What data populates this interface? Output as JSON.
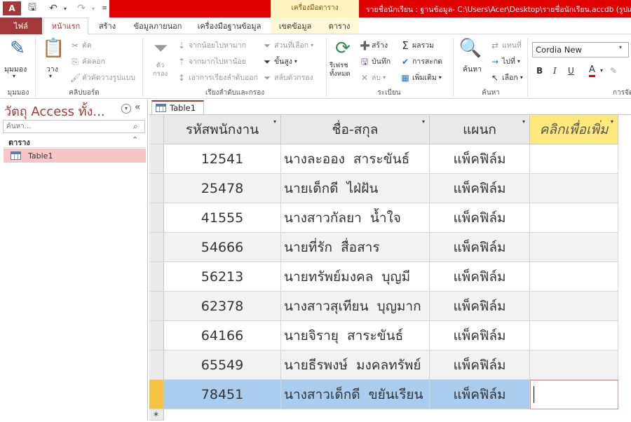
{
  "app": {
    "title": "รายชื่อนักเรียน : ฐานข้อมูล- C:\\Users\\Acer\\Desktop\\รายชื่อนักเรียน.accdb (รูปแบ",
    "context_group": "เครื่องมือตาราง",
    "app_icon_label": "A"
  },
  "tabs": {
    "file": "ไฟล์",
    "items": [
      "หน้าแรก",
      "สร้าง",
      "ข้อมูลภายนอก",
      "เครื่องมือฐานข้อมูล",
      "เขตข้อมูล",
      "ตาราง"
    ],
    "active_index": 0
  },
  "ribbon": {
    "views": {
      "label": "มุมมอง",
      "group": "มุมมอง"
    },
    "clipboard": {
      "paste": "วาง",
      "cut": "ตัด",
      "copy": "คัดลอก",
      "format_painter": "ตัวคัดวางรูปแบบ",
      "group": "คลิปบอร์ด"
    },
    "sort_filter": {
      "filter": "ตัว\nกรอง",
      "ascending": "จากน้อยไปหามาก",
      "descending": "จากมากไปหาน้อย",
      "remove_sort": "เอาการเรียงลำดับออก",
      "selection": "ส่วนที่เลือก",
      "advanced": "ขั้นสูง",
      "toggle_filter": "สลับตัวกรอง",
      "group": "เรียงลำดับและกรอง"
    },
    "records": {
      "refresh": "รีเฟรช\nทั้งหมด",
      "new": "สร้าง",
      "save": "บันทึก",
      "delete": "ลบ",
      "totals": "ผลรวม",
      "spelling": "การสะกด",
      "more": "เพิ่มเติม",
      "group": "ระเบียน"
    },
    "find": {
      "find": "ค้นหา",
      "replace": "แทนที่",
      "goto": "ไปที่",
      "select": "เลือก",
      "group": "ค้นหา"
    },
    "text_formatting": {
      "font": "Cordia New",
      "bold": "B",
      "italic": "I",
      "underline": "U",
      "font_color": "A",
      "group": "การจัด"
    }
  },
  "nav": {
    "title": "วัตถุ Access ทั้ง...",
    "search_placeholder": "ค้นหา...",
    "group": "ตาราง",
    "items": [
      "Table1"
    ]
  },
  "document": {
    "tab": "Table1",
    "columns": [
      "รหัสพนักงาน",
      "ชื่อ-สกุล",
      "แผนก",
      "คลิกเพื่อเพิ่ม"
    ],
    "rows": [
      [
        "12541",
        "นางละออง สาระขันธ์",
        "แพ็คฟิล์ม",
        ""
      ],
      [
        "25478",
        "นายเด็กดี ไฝ่ฝัน",
        "แพ็คฟิล์ม",
        ""
      ],
      [
        "41555",
        "นางสาวกัลยา น้ำใจ",
        "แพ็คฟิล์ม",
        ""
      ],
      [
        "54666",
        "นายที่รัก สื่อสาร",
        "แพ็คฟิล์ม",
        ""
      ],
      [
        "56213",
        "นายทรัพย์มงคล บุญมี",
        "แพ็คฟิล์ม",
        ""
      ],
      [
        "62378",
        "นางสาวสุเทียน บุญมาก",
        "แพ็คฟิล์ม",
        ""
      ],
      [
        "64166",
        "นายจิรายุ สาระขันธ์",
        "แพ็คฟิล์ม",
        ""
      ],
      [
        "65549",
        "นายธีรพงษ์ มงคลทรัพย์",
        "แพ็คฟิล์ม",
        ""
      ],
      [
        "78451",
        "นางสาวเด็กดี ขยันเรียน",
        "แพ็คฟิล์ม",
        ""
      ]
    ],
    "selected_row": 8,
    "new_row_marker": "*"
  },
  "colors": {
    "accent": "#a4373a",
    "title_bar": "#e00000",
    "selected_row": "#a9cdee",
    "add_column": "#fde97c"
  }
}
